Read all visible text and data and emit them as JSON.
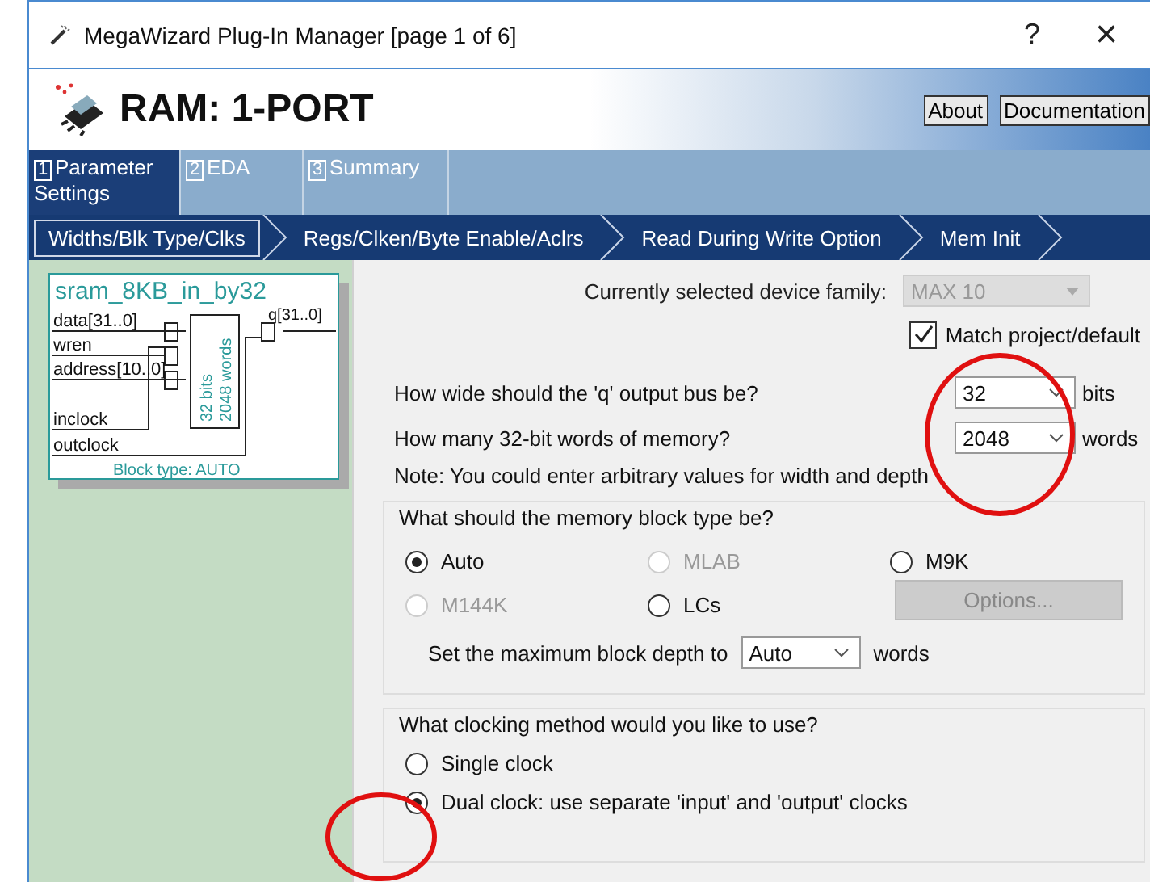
{
  "window": {
    "title": "MegaWizard Plug-In Manager [page 1 of 6]",
    "help": "?",
    "close": "×"
  },
  "header": {
    "title": "RAM: 1-PORT",
    "buttons": [
      "About",
      "Documentation"
    ]
  },
  "tabs": [
    {
      "number": "1",
      "label": "Parameter Settings",
      "selected": true
    },
    {
      "number": "2",
      "label": "EDA",
      "selected": false
    },
    {
      "number": "3",
      "label": "Summary",
      "selected": false
    }
  ],
  "steps": [
    {
      "label": "Widths/Blk Type/Clks",
      "selected": true
    },
    {
      "label": "Regs/Clken/Byte Enable/Aclrs",
      "selected": false
    },
    {
      "label": "Read During Write Option",
      "selected": false
    },
    {
      "label": "Mem Init",
      "selected": false
    }
  ],
  "diagram": {
    "name": "sram_8KB_in_by32",
    "inputs": [
      "data[31..0]",
      "wren",
      "address[10..0]"
    ],
    "output": "q[31..0]",
    "clocks": [
      "inclock",
      "outclock"
    ],
    "block_lines": [
      "32 bits",
      "2048 words"
    ],
    "block_type": "Block type: AUTO"
  },
  "device_family": {
    "label": "Currently selected device family:",
    "value": "MAX 10",
    "disabled": true
  },
  "match": {
    "label": "Match project/default",
    "checked": true
  },
  "questions": [
    {
      "label": "How wide should the 'q' output bus be?",
      "value": "32",
      "unit": "bits"
    },
    {
      "label": "How many 32-bit words of memory?",
      "value": "2048",
      "unit": "words"
    }
  ],
  "note": "Note: You could enter arbitrary values for width and depth",
  "block_type": {
    "title": "What should the memory block type be?",
    "options": [
      {
        "label": "Auto",
        "selected": true,
        "disabled": false
      },
      {
        "label": "MLAB",
        "selected": false,
        "disabled": true
      },
      {
        "label": "M9K",
        "selected": false,
        "disabled": false
      },
      {
        "label": "M144K",
        "selected": false,
        "disabled": true
      },
      {
        "label": "LCs",
        "selected": false,
        "disabled": false
      }
    ],
    "options_button": {
      "label": "Options...",
      "disabled": true
    },
    "max_depth": {
      "label": "Set the maximum block depth to",
      "value": "Auto",
      "unit": "words"
    }
  },
  "clocking": {
    "title": "What clocking method would you like to use?",
    "options": [
      {
        "label": "Single clock",
        "selected": false
      },
      {
        "label": "Dual clock: use separate 'input' and 'output' clocks",
        "selected": true
      }
    ]
  }
}
